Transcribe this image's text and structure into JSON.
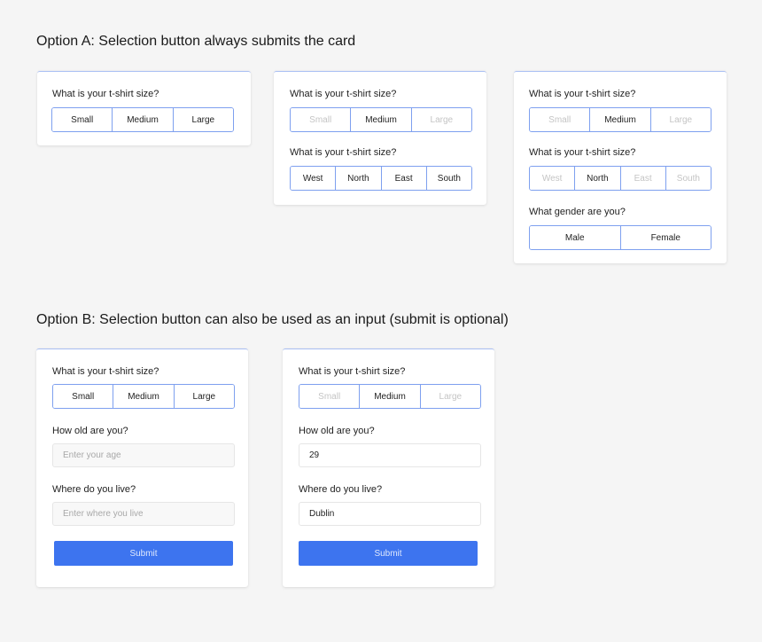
{
  "option_a": {
    "title": "Option A: Selection button always submits the card",
    "cards": [
      {
        "groups": [
          {
            "question": "What is your t-shirt size?",
            "options": [
              {
                "label": "Small",
                "dimmed": false
              },
              {
                "label": "Medium",
                "dimmed": false
              },
              {
                "label": "Large",
                "dimmed": false
              }
            ]
          }
        ]
      },
      {
        "groups": [
          {
            "question": "What is your t-shirt size?",
            "options": [
              {
                "label": "Small",
                "dimmed": true
              },
              {
                "label": "Medium",
                "dimmed": false
              },
              {
                "label": "Large",
                "dimmed": true
              }
            ]
          },
          {
            "question": "What is your t-shirt size?",
            "options": [
              {
                "label": "West",
                "dimmed": false
              },
              {
                "label": "North",
                "dimmed": false
              },
              {
                "label": "East",
                "dimmed": false
              },
              {
                "label": "South",
                "dimmed": false
              }
            ]
          }
        ]
      },
      {
        "groups": [
          {
            "question": "What is your t-shirt size?",
            "options": [
              {
                "label": "Small",
                "dimmed": true
              },
              {
                "label": "Medium",
                "dimmed": false
              },
              {
                "label": "Large",
                "dimmed": true
              }
            ]
          },
          {
            "question": "What is your t-shirt size?",
            "options": [
              {
                "label": "West",
                "dimmed": true
              },
              {
                "label": "North",
                "dimmed": false
              },
              {
                "label": "East",
                "dimmed": true
              },
              {
                "label": "South",
                "dimmed": true
              }
            ]
          },
          {
            "question": "What gender are you?",
            "options": [
              {
                "label": "Male",
                "dimmed": false
              },
              {
                "label": "Female",
                "dimmed": false
              }
            ]
          }
        ]
      }
    ]
  },
  "option_b": {
    "title": "Option B: Selection button can also be used as an input (submit is optional)",
    "cards": [
      {
        "size_question": "What is your t-shirt size?",
        "size_options": [
          {
            "label": "Small",
            "dimmed": false
          },
          {
            "label": "Medium",
            "dimmed": false
          },
          {
            "label": "Large",
            "dimmed": false
          }
        ],
        "age_question": "How old are you?",
        "age_placeholder": "Enter your age",
        "age_value": "",
        "location_question": "Where do you live?",
        "location_placeholder": "Enter where you live",
        "location_value": "",
        "submit_label": "Submit"
      },
      {
        "size_question": "What is your t-shirt size?",
        "size_options": [
          {
            "label": "Small",
            "dimmed": true
          },
          {
            "label": "Medium",
            "dimmed": false
          },
          {
            "label": "Large",
            "dimmed": true
          }
        ],
        "age_question": "How old are you?",
        "age_placeholder": "",
        "age_value": "29",
        "location_question": "Where do you live?",
        "location_placeholder": "",
        "location_value": "Dublin",
        "submit_label": "Submit"
      }
    ]
  },
  "colors": {
    "accent": "#3d74ef",
    "segment_border": "#7ea0ef",
    "dimmed_text": "#c4c4c4",
    "page_background": "#f5f5f5"
  }
}
